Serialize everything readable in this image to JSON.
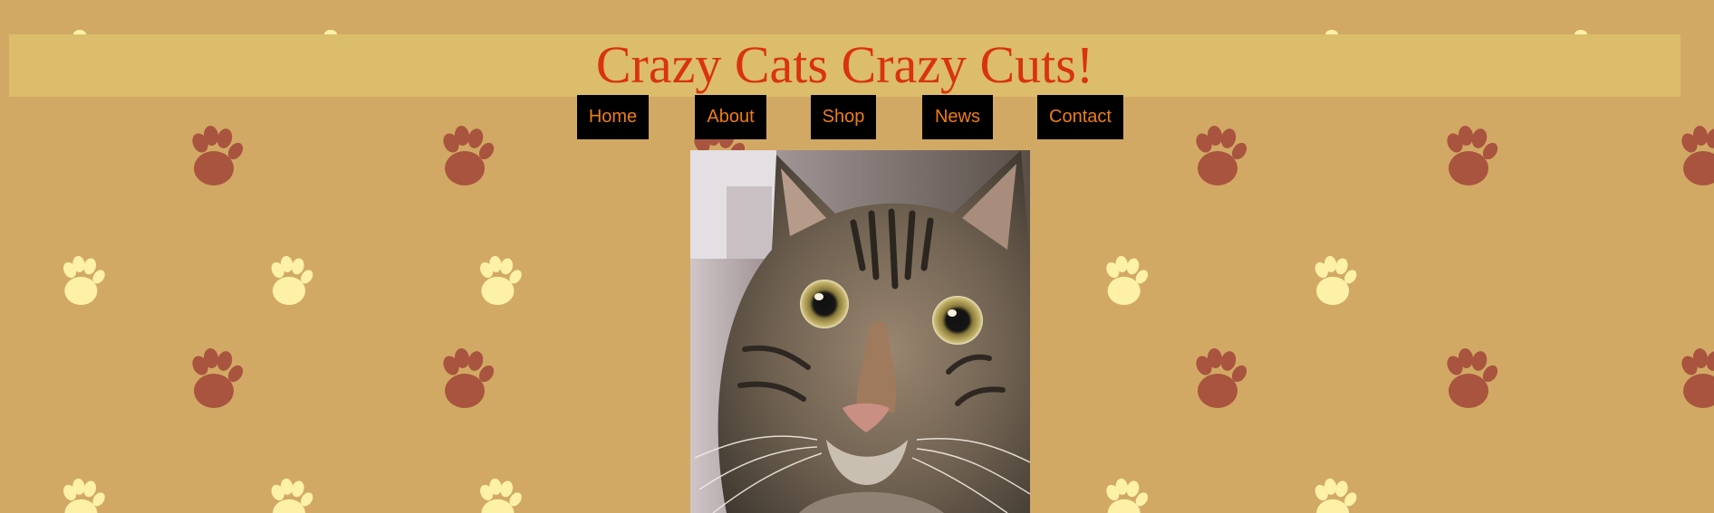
{
  "header": {
    "title": "Crazy Cats Crazy Cuts!"
  },
  "nav": {
    "items": [
      {
        "label": "Home"
      },
      {
        "label": "About"
      },
      {
        "label": "Shop"
      },
      {
        "label": "News"
      },
      {
        "label": "Contact"
      }
    ]
  },
  "colors": {
    "background": "#d2a964",
    "banner": "#dbbd6b",
    "title": "#d9340c",
    "nav_background": "#000000",
    "nav_text": "#f07d12",
    "paw_dark": "#a8543f",
    "paw_light": "#fdf1a8"
  },
  "images": {
    "hero": "tabby-cat-photo",
    "background_pattern": "paw-print-icon"
  }
}
